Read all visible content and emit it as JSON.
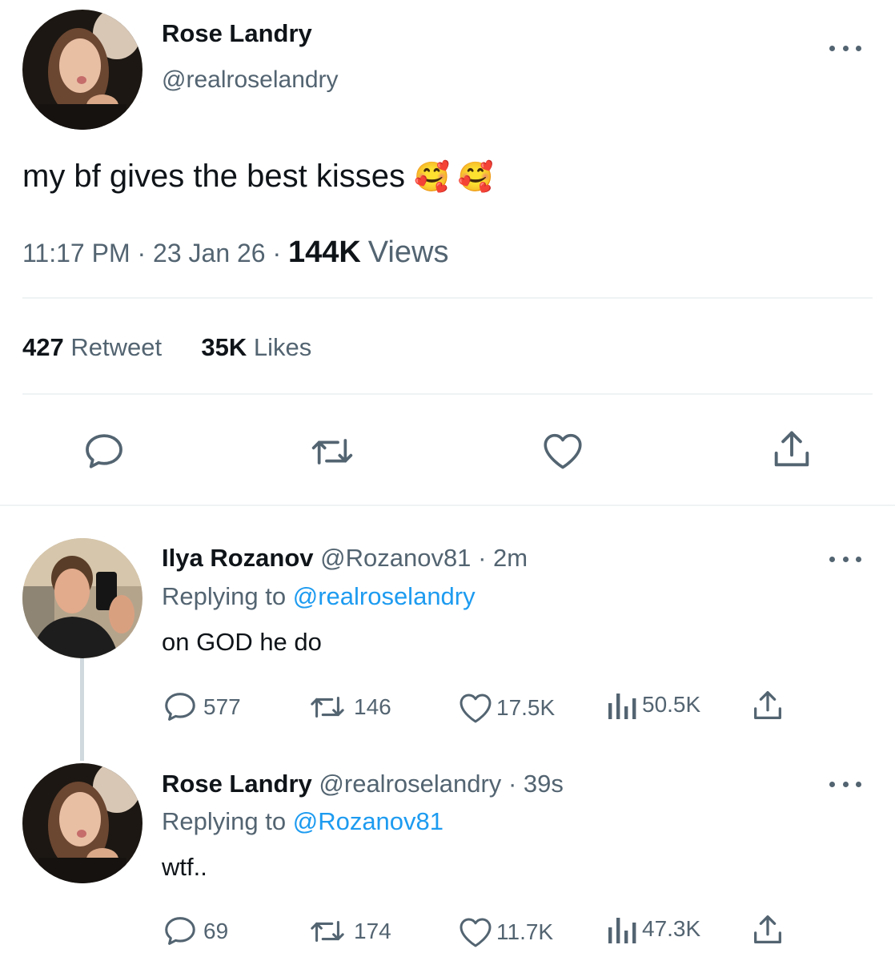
{
  "main_tweet": {
    "author_name": "Rose Landry",
    "author_handle": "@realroselandry",
    "text": "my bf gives the best kisses",
    "emoji": "🥰 🥰",
    "time": "11:17 PM",
    "date": "23 Jan 26",
    "views_count": "144K",
    "views_label": "Views",
    "retweets_count": "427",
    "retweets_label": "Retweet",
    "likes_count": "35K",
    "likes_label": "Likes"
  },
  "replies": [
    {
      "author_name": "Ilya Rozanov",
      "author_handle": "@Rozanov81",
      "age": "2m",
      "replying_to_label": "Replying to",
      "replying_to_handle": "@realroselandry",
      "text": "on GOD he do",
      "replies": "577",
      "retweets": "146",
      "likes": "17.5K",
      "views": "50.5K"
    },
    {
      "author_name": "Rose Landry",
      "author_handle": "@realroselandry",
      "age": "39s",
      "replying_to_label": "Replying to",
      "replying_to_handle": "@Rozanov81",
      "text": "wtf..",
      "replies": "69",
      "retweets": "174",
      "likes": "11.7K",
      "views": "47.3K"
    }
  ],
  "icons": [
    "reply-icon",
    "retweet-icon",
    "like-icon",
    "share-icon",
    "views-icon",
    "more-icon"
  ],
  "colors": {
    "text": "#0f1419",
    "secondary": "#536471",
    "link": "#1d9bf0",
    "divider": "#eff3f4"
  }
}
